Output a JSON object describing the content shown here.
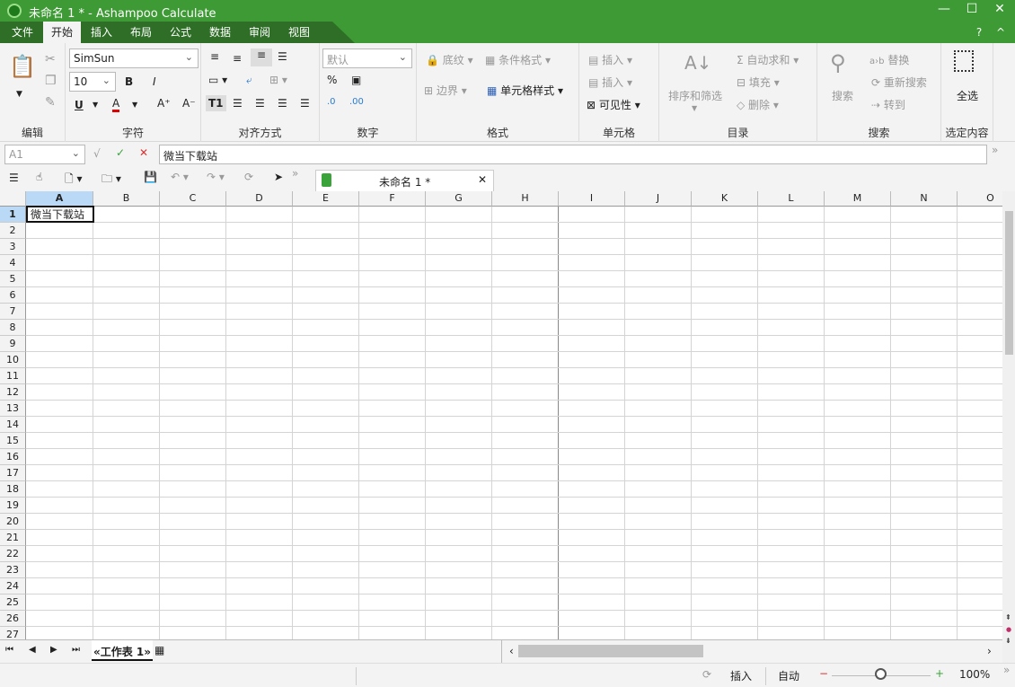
{
  "window": {
    "title": "未命名 1 * - Ashampoo Calculate",
    "minimize": "—",
    "maximize": "☐",
    "close": "✕"
  },
  "menu": {
    "tabs": [
      "文件",
      "开始",
      "插入",
      "布局",
      "公式",
      "数据",
      "审阅",
      "视图"
    ],
    "active": 1,
    "help": "?",
    "collapse": "^"
  },
  "ribbon": {
    "edit": {
      "label": "编辑"
    },
    "font": {
      "label": "字符",
      "font_name": "SimSun",
      "font_size": "10",
      "bold": "B",
      "italic": "I",
      "underline": "U",
      "font_color": "A",
      "grow": "A⁺",
      "shrink": "A⁻",
      "font_color_hex": "#e00000"
    },
    "align": {
      "label": "对齐方式"
    },
    "number": {
      "label": "数字",
      "format": "默认",
      "percent": "%",
      "inc_dec": ".0",
      "dec_dec": ".00"
    },
    "format": {
      "label": "格式",
      "shading": "底纹",
      "conditional": "条件格式",
      "border": "边界",
      "cell_style": "单元格样式"
    },
    "cells": {
      "label": "单元格",
      "insert1": "插入",
      "insert2": "插入",
      "visibility": "可见性"
    },
    "catalog": {
      "label": "目录",
      "sort": "排序和筛选",
      "autosum": "自动求和",
      "fill": "填充",
      "delete": "删除"
    },
    "search": {
      "label": "搜索",
      "search": "搜索",
      "replace": "替换",
      "research": "重新搜索",
      "goto": "转到",
      "ab": "a›b"
    },
    "selection": {
      "label": "选定内容",
      "select_all": "全选"
    }
  },
  "formula_bar": {
    "cell_ref": "A1",
    "content": "微当下载站"
  },
  "doc_tab": {
    "title": "未命名 1 *"
  },
  "grid": {
    "columns": [
      "A",
      "B",
      "C",
      "D",
      "E",
      "F",
      "G",
      "H",
      "I",
      "J",
      "K",
      "L",
      "M",
      "N",
      "O"
    ],
    "rows": 27,
    "selected_cell": "A1",
    "cells": {
      "A1": "微当下载站"
    }
  },
  "sheets": {
    "tabs": [
      "«工作表 1»"
    ]
  },
  "status": {
    "mode": "插入",
    "calc": "自动",
    "zoom": "100%",
    "zoom_percent": 100,
    "minus": "−",
    "plus": "+"
  },
  "colors": {
    "accent": "#3d9a34",
    "dark_accent": "#2f6e27",
    "selection": "#b9d9f7"
  }
}
